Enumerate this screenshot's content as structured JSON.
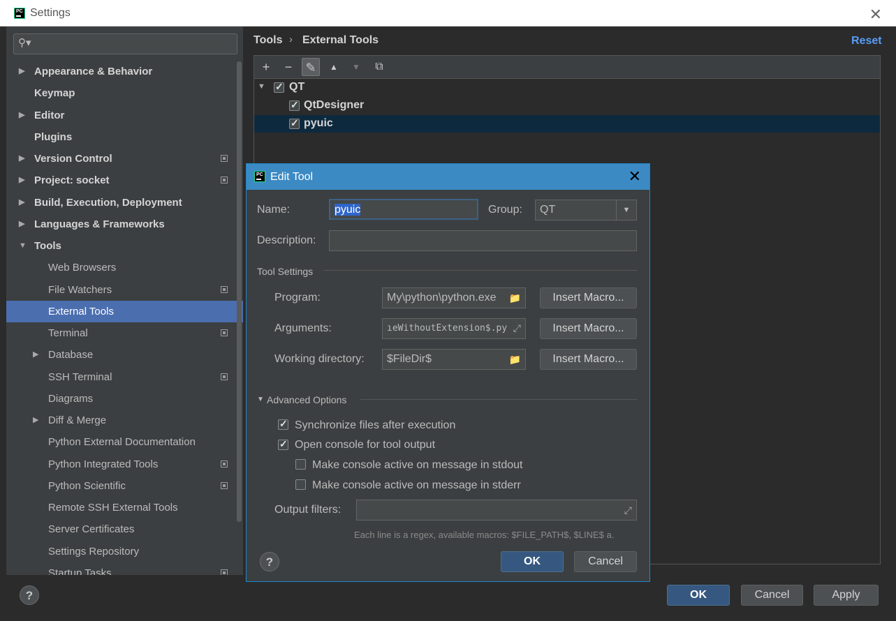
{
  "window": {
    "title": "Settings",
    "close": "✕"
  },
  "search": {
    "placeholder": ""
  },
  "sidebar": {
    "items": [
      {
        "label": "Appearance & Behavior"
      },
      {
        "label": "Keymap"
      },
      {
        "label": "Editor"
      },
      {
        "label": "Plugins"
      },
      {
        "label": "Version Control"
      },
      {
        "label": "Project: socket"
      },
      {
        "label": "Build, Execution, Deployment"
      },
      {
        "label": "Languages & Frameworks"
      },
      {
        "label": "Tools"
      },
      {
        "label": "Web Browsers"
      },
      {
        "label": "File Watchers"
      },
      {
        "label": "External Tools"
      },
      {
        "label": "Terminal"
      },
      {
        "label": "Database"
      },
      {
        "label": "SSH Terminal"
      },
      {
        "label": "Diagrams"
      },
      {
        "label": "Diff & Merge"
      },
      {
        "label": "Python External Documentation"
      },
      {
        "label": "Python Integrated Tools"
      },
      {
        "label": "Python Scientific"
      },
      {
        "label": "Remote SSH External Tools"
      },
      {
        "label": "Server Certificates"
      },
      {
        "label": "Settings Repository"
      },
      {
        "label": "Startup Tasks"
      }
    ],
    "selected": "External Tools"
  },
  "breadcrumb": {
    "parent": "Tools",
    "separator": "›",
    "current": "External Tools"
  },
  "reset_label": "Reset",
  "tools_tree": {
    "group": "QT",
    "tools": [
      "QtDesigner",
      "pyuic"
    ],
    "selected": "pyuic"
  },
  "toolbar": {
    "add": "+",
    "remove": "−",
    "edit": "✎",
    "up": "▲",
    "down": "▼",
    "copy": "⧉"
  },
  "footer": {
    "ok": "OK",
    "cancel": "Cancel",
    "apply": "Apply",
    "help": "?"
  },
  "dialog": {
    "title": "Edit Tool",
    "name_label": "Name:",
    "name_value": "pyuic",
    "group_label": "Group:",
    "group_value": "QT",
    "description_label": "Description:",
    "description_value": "",
    "tool_settings": "Tool Settings",
    "program_label": "Program:",
    "program_value": "My\\python\\python.exe",
    "arguments_label": "Arguments:",
    "arguments_value": "ıeWithoutExtension$.py",
    "workdir_label": "Working directory:",
    "workdir_value": "$FileDir$",
    "insert_macro": "Insert Macro...",
    "advanced": "Advanced Options",
    "sync_label": "Synchronize files after execution",
    "sync_checked": true,
    "console_label": "Open console for tool output",
    "console_checked": true,
    "stdout_label": "Make console active on message in stdout",
    "stdout_checked": false,
    "stderr_label": "Make console active on message in stderr",
    "stderr_checked": false,
    "output_filters_label": "Output filters:",
    "output_filters_value": "",
    "hint": "Each line is a regex, available macros: $FILE_PATH$, $LINE$ a.",
    "ok": "OK",
    "cancel": "Cancel",
    "help": "?"
  },
  "colors": {
    "accent": "#4b6eaf",
    "primary_button": "#365880",
    "dialog_title": "#3c8ac4",
    "link": "#589df6"
  }
}
